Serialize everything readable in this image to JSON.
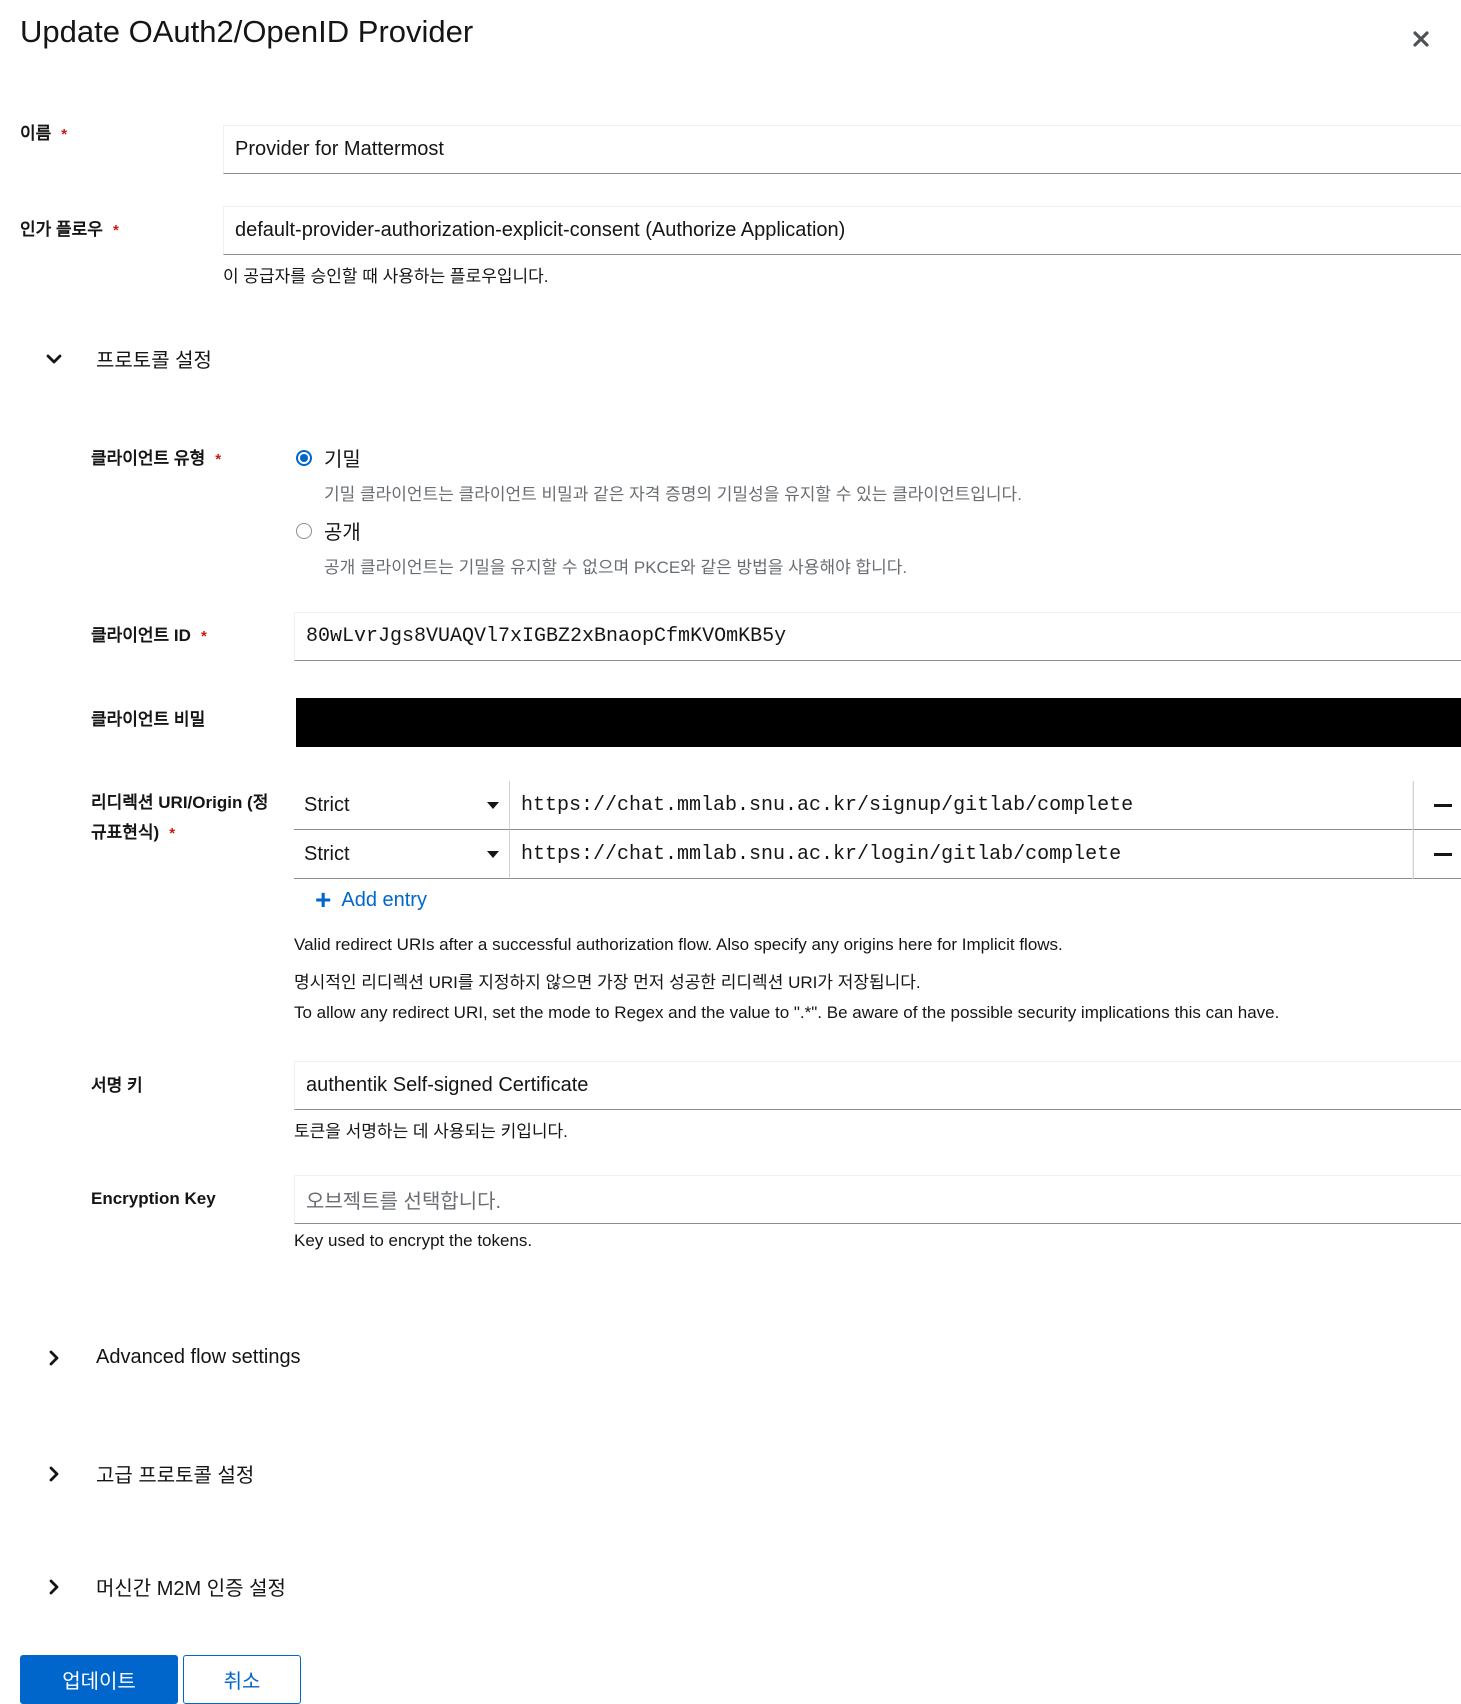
{
  "dialog": {
    "title": "Update OAuth2/OpenID Provider",
    "close_icon": "close-icon"
  },
  "name": {
    "label": "이름",
    "required": "*",
    "value": "Provider for Mattermost"
  },
  "auth_flow": {
    "label": "인가 플로우",
    "required": "*",
    "value": "default-provider-authorization-explicit-consent (Authorize Application)",
    "help": "이 공급자를 승인할 때 사용하는 플로우입니다."
  },
  "protocol_settings": {
    "label": "프로토콜 설정",
    "expanded": true,
    "client_type": {
      "label": "클라이언트 유형",
      "required": "*",
      "options": [
        {
          "label": "기밀",
          "description": "기밀 클라이언트는 클라이언트 비밀과 같은 자격 증명의 기밀성을 유지할 수 있는 클라이언트입니다.",
          "checked": true
        },
        {
          "label": "공개",
          "description": "공개 클라이언트는 기밀을 유지할 수 없으며 PKCE와 같은 방법을 사용해야 합니다.",
          "checked": false
        }
      ]
    },
    "client_id": {
      "label": "클라이언트 ID",
      "required": "*",
      "value": "80wLvrJgs8VUAQVl7xIGBZ2xBnaopCfmKVOmKB5y"
    },
    "client_secret": {
      "label": "클라이언트 비밀"
    },
    "redirect_uris": {
      "label_line1": "리디렉션 URI/Origin (정",
      "label_line2": "규표현식)",
      "required": "*",
      "entries": [
        {
          "mode": "Strict",
          "url": "https://chat.mmlab.snu.ac.kr/signup/gitlab/complete"
        },
        {
          "mode": "Strict",
          "url": "https://chat.mmlab.snu.ac.kr/login/gitlab/complete"
        }
      ],
      "add_entry": "Add entry",
      "help1": "Valid redirect URIs after a successful authorization flow. Also specify any origins here for Implicit flows.",
      "help2": "명시적인 리디렉션 URI를 지정하지 않으면 가장 먼저 성공한 리디렉션 URI가 저장됩니다.",
      "help3": "To allow any redirect URI, set the mode to Regex and the value to \".*\". Be aware of the possible security implications this can have."
    },
    "signing_key": {
      "label": "서명 키",
      "value": "authentik Self-signed Certificate",
      "help": "토큰을 서명하는 데 사용되는 키입니다."
    },
    "encryption_key": {
      "label": "Encryption Key",
      "placeholder": "오브젝트를 선택합니다.",
      "help": "Key used to encrypt the tokens."
    }
  },
  "sections": {
    "advanced_flow": "Advanced flow settings",
    "advanced_protocol": "고급 프로토콜 설정",
    "m2m": "머신간 M2M 인증 설정"
  },
  "actions": {
    "update": "업데이트",
    "cancel": "취소"
  },
  "colors": {
    "primary": "#0066cc",
    "required": "#c9190b",
    "redacted": "#000000"
  }
}
